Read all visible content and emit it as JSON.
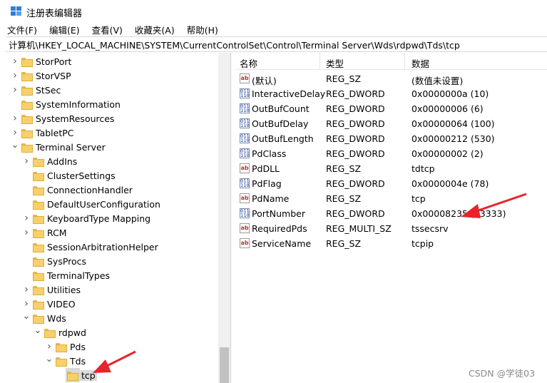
{
  "window": {
    "title": "注册表编辑器",
    "icon": "regedit-icon"
  },
  "menu": {
    "file": "文件(F)",
    "edit": "编辑(E)",
    "view": "查看(V)",
    "favorites": "收藏夹(A)",
    "help": "帮助(H)"
  },
  "address": {
    "path": "计算机\\HKEY_LOCAL_MACHINE\\SYSTEM\\CurrentControlSet\\Control\\Terminal Server\\Wds\\rdpwd\\Tds\\tcp"
  },
  "tree": {
    "items": [
      {
        "label": "StorPort",
        "expand": "collapsed"
      },
      {
        "label": "StorVSP",
        "expand": "collapsed"
      },
      {
        "label": "StSec",
        "expand": "collapsed"
      },
      {
        "label": "SystemInformation",
        "expand": "none"
      },
      {
        "label": "SystemResources",
        "expand": "collapsed"
      },
      {
        "label": "TabletPC",
        "expand": "collapsed"
      },
      {
        "label": "Terminal Server",
        "expand": "expanded"
      },
      {
        "label": "AddIns",
        "expand": "collapsed"
      },
      {
        "label": "ClusterSettings",
        "expand": "none"
      },
      {
        "label": "ConnectionHandler",
        "expand": "none"
      },
      {
        "label": "DefaultUserConfiguration",
        "expand": "none"
      },
      {
        "label": "KeyboardType Mapping",
        "expand": "collapsed"
      },
      {
        "label": "RCM",
        "expand": "collapsed"
      },
      {
        "label": "SessionArbitrationHelper",
        "expand": "none"
      },
      {
        "label": "SysProcs",
        "expand": "none"
      },
      {
        "label": "TerminalTypes",
        "expand": "none"
      },
      {
        "label": "Utilities",
        "expand": "collapsed"
      },
      {
        "label": "VIDEO",
        "expand": "collapsed"
      },
      {
        "label": "Wds",
        "expand": "expanded"
      },
      {
        "label": "rdpwd",
        "expand": "expanded"
      },
      {
        "label": "Pds",
        "expand": "collapsed"
      },
      {
        "label": "Tds",
        "expand": "expanded"
      },
      {
        "label": "tcp",
        "expand": "none",
        "selected": true
      }
    ]
  },
  "list": {
    "headers": {
      "name": "名称",
      "type": "类型",
      "data": "数据"
    },
    "rows": [
      {
        "name": "(默认)",
        "type": "REG_SZ",
        "data": "(数值未设置)",
        "icon": "string-value-icon"
      },
      {
        "name": "InteractiveDelay",
        "type": "REG_DWORD",
        "data": "0x0000000a (10)",
        "icon": "dword-value-icon"
      },
      {
        "name": "OutBufCount",
        "type": "REG_DWORD",
        "data": "0x00000006 (6)",
        "icon": "dword-value-icon"
      },
      {
        "name": "OutBufDelay",
        "type": "REG_DWORD",
        "data": "0x00000064 (100)",
        "icon": "dword-value-icon"
      },
      {
        "name": "OutBufLength",
        "type": "REG_DWORD",
        "data": "0x00000212 (530)",
        "icon": "dword-value-icon"
      },
      {
        "name": "PdClass",
        "type": "REG_DWORD",
        "data": "0x00000002 (2)",
        "icon": "dword-value-icon"
      },
      {
        "name": "PdDLL",
        "type": "REG_SZ",
        "data": "tdtcp",
        "icon": "string-value-icon"
      },
      {
        "name": "PdFlag",
        "type": "REG_DWORD",
        "data": "0x0000004e (78)",
        "icon": "dword-value-icon"
      },
      {
        "name": "PdName",
        "type": "REG_SZ",
        "data": "tcp",
        "icon": "string-value-icon"
      },
      {
        "name": "PortNumber",
        "type": "REG_DWORD",
        "data": "0x00008235 (33333)",
        "icon": "dword-value-icon"
      },
      {
        "name": "RequiredPds",
        "type": "REG_MULTI_SZ",
        "data": "tssecsrv",
        "icon": "string-value-icon"
      },
      {
        "name": "ServiceName",
        "type": "REG_SZ",
        "data": "tcpip",
        "icon": "string-value-icon"
      }
    ]
  },
  "watermark": "CSDN @学徒03",
  "colors": {
    "annotation_arrow": "#e8232a",
    "folder": "#f7d06b",
    "selection": "#d9d9d9"
  }
}
